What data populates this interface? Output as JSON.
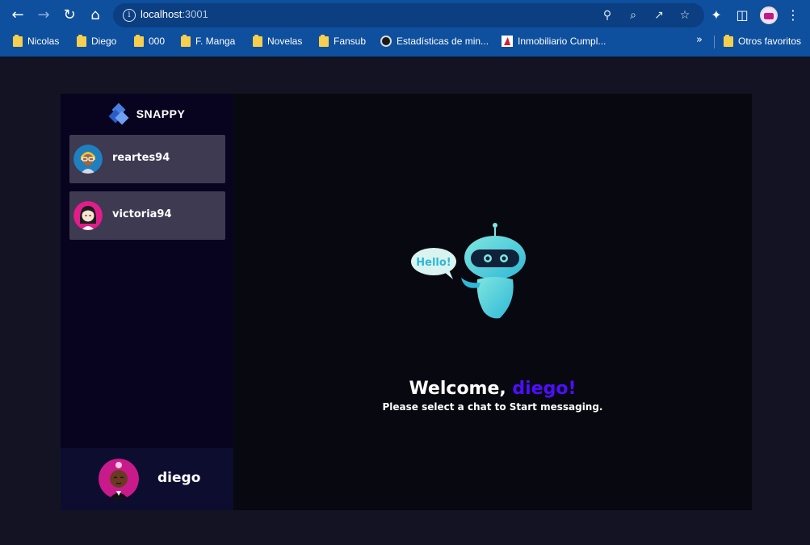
{
  "browser": {
    "url_host": "localhost",
    "url_port": ":3001",
    "bookmarks": [
      {
        "label": "Nicolas",
        "icon": "folder-icon"
      },
      {
        "label": "Diego",
        "icon": "folder-icon"
      },
      {
        "label": "000",
        "icon": "folder-icon"
      },
      {
        "label": "F. Manga",
        "icon": "folder-icon"
      },
      {
        "label": "Novelas",
        "icon": "folder-icon"
      },
      {
        "label": "Fansub",
        "icon": "folder-icon"
      },
      {
        "label": "Estadísticas de min...",
        "icon": "site-icon"
      },
      {
        "label": "Inmobiliario Cumpl...",
        "icon": "site-icon"
      }
    ],
    "other_bookmarks": "Otros favoritos",
    "more_bookmarks": "»"
  },
  "app": {
    "brand": "SNAPPY",
    "contacts": [
      {
        "username": "reartes94"
      },
      {
        "username": "victoria94"
      }
    ],
    "current_user": {
      "username": "diego"
    },
    "welcome": {
      "prefix": "Welcome, ",
      "username": "diego!",
      "subtitle": "Please select a chat to Start messaging.",
      "bubble": "Hello!"
    }
  },
  "colors": {
    "accent": "#4e0eff",
    "contact_bg": "#3d3a52",
    "sidebar_bg": "#080420",
    "page_bg": "#131324"
  }
}
